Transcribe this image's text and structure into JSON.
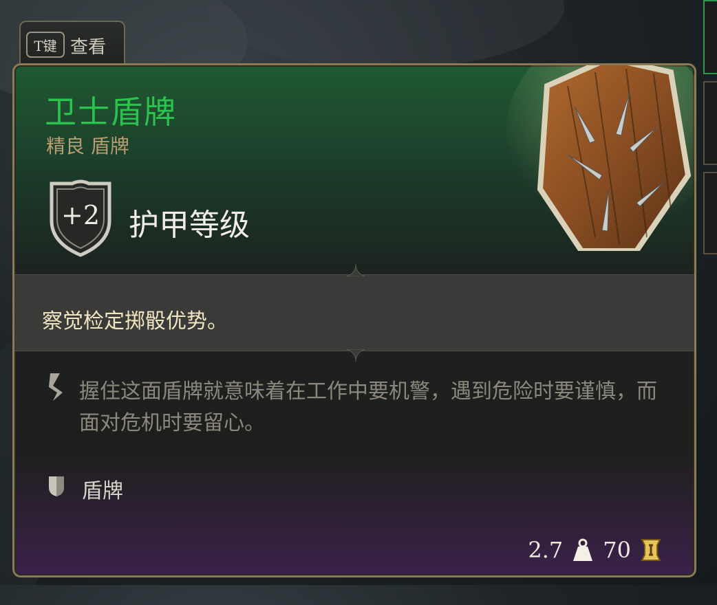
{
  "tab": {
    "key": "T键",
    "label": "查看"
  },
  "item": {
    "name": "卫士盾牌",
    "rarity_type": "精良 盾牌",
    "armor_bonus": "+2",
    "armor_label": "护甲等级",
    "effect": "察觉检定掷骰优势。",
    "flavor_text": "握住这面盾牌就意味着在工作中要机警，遇到危险时要谨慎，而面对危机时要留心。",
    "category": "盾牌",
    "weight": "2.7",
    "value": "70"
  },
  "colors": {
    "name_color": "#2bc24e",
    "subtitle_color": "#b79d71",
    "effect_color": "#f2e6c2",
    "flavor_color": "#8c877c"
  },
  "icons": {
    "armor": "shield-icon",
    "flavor": "quill-icon",
    "category": "shield-small-icon",
    "weight": "weight-icon",
    "value": "gold-coin-icon"
  }
}
